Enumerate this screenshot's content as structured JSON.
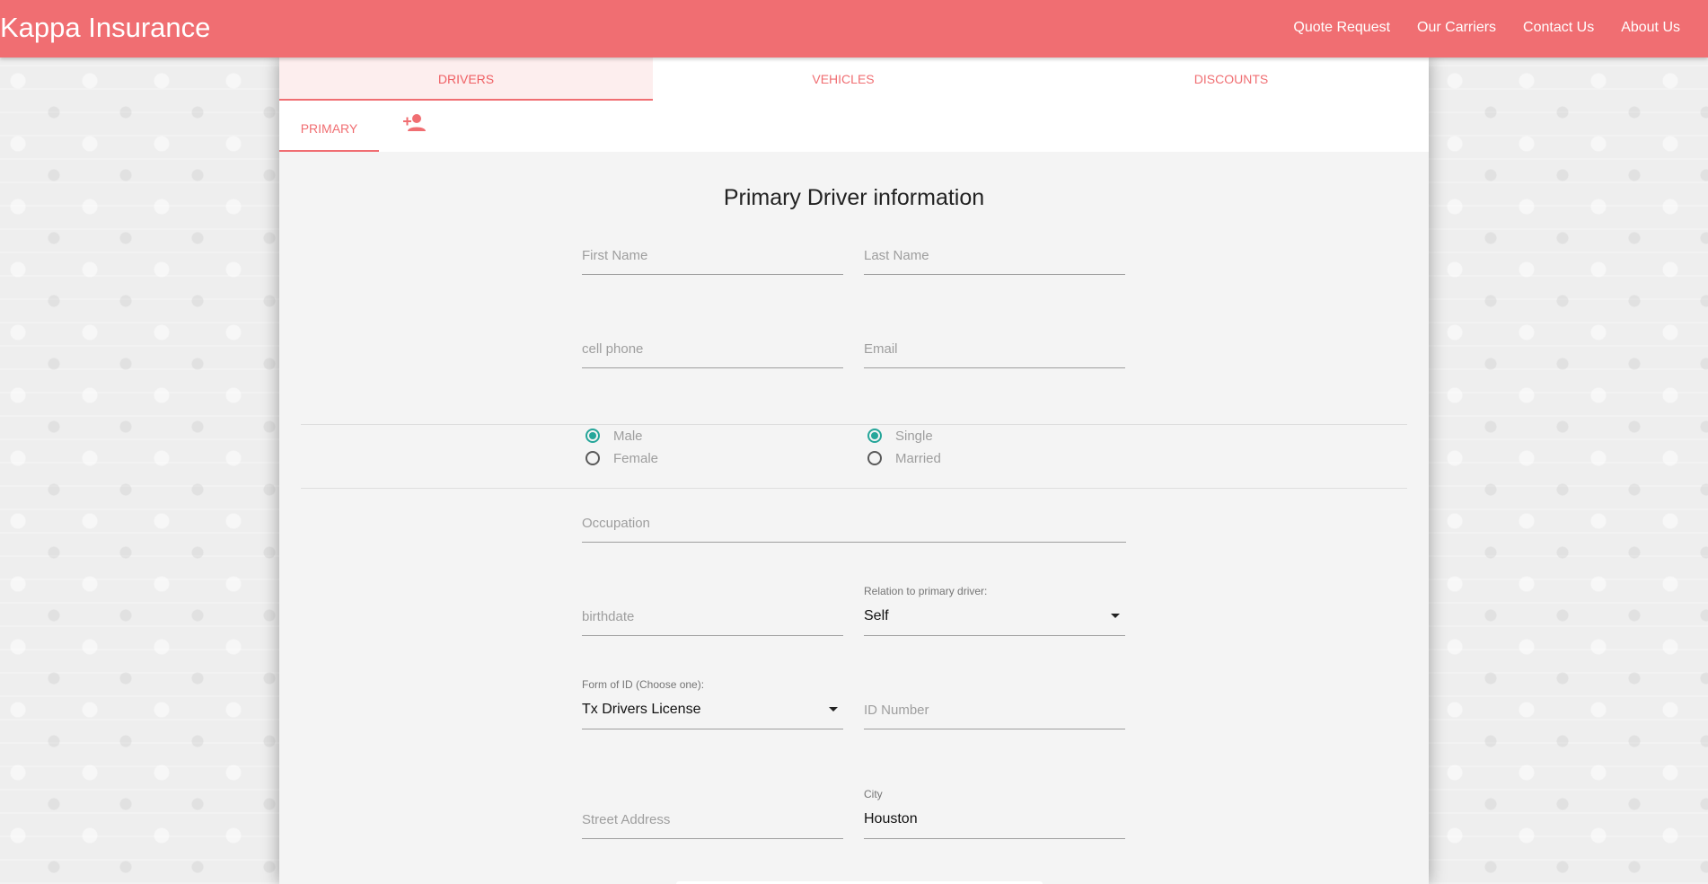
{
  "navbar": {
    "brand": "Kappa Insurance",
    "links": [
      "Quote Request",
      "Our Carriers",
      "Contact Us",
      "About Us"
    ]
  },
  "tabs": [
    "DRIVERS",
    "VEHICLES",
    "DISCOUNTS"
  ],
  "subtabs": {
    "primary": "PRIMARY",
    "add_icon": "person-add-icon"
  },
  "form": {
    "title": "Primary Driver information",
    "first_name_placeholder": "First Name",
    "last_name_placeholder": "Last Name",
    "cell_phone_placeholder": "cell phone",
    "email_placeholder": "Email",
    "gender": {
      "options": [
        "Male",
        "Female"
      ],
      "selected": "Male"
    },
    "marital": {
      "options": [
        "Single",
        "Married"
      ],
      "selected": "Single"
    },
    "occupation_placeholder": "Occupation",
    "birthdate_placeholder": "birthdate",
    "relation_label": "Relation to primary driver:",
    "relation_value": "Self",
    "id_form_label": "Form of ID (Choose one):",
    "id_form_value": "Tx Drivers License",
    "id_number_placeholder": "ID Number",
    "street_placeholder": "Street Address",
    "city_label": "City",
    "city_value": "Houston"
  },
  "colors": {
    "primary": "#f06e72",
    "radio_checked": "#26a69a",
    "card_bg": "#f4f4f4"
  }
}
